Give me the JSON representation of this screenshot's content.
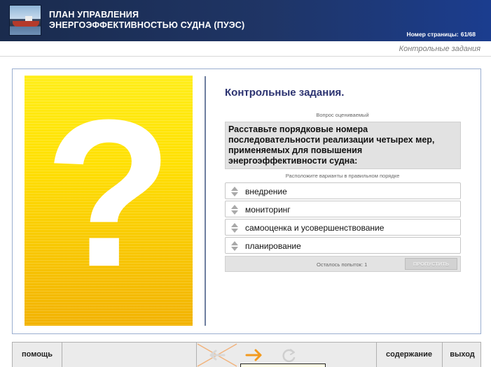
{
  "header": {
    "title_line1": "ПЛАН УПРАВЛЕНИЯ",
    "title_line2": "ЭНЕРГОЭФФЕКТИВНОСТЬЮ СУДНА (ПУЭС)",
    "page_label": "Номер страницы:",
    "page_value": "61/68",
    "thumbnail_icon": "ship-photo"
  },
  "breadcrumb": "Контрольные задания",
  "main": {
    "illustration_glyph": "?",
    "section_title": "Контрольные задания.",
    "question_caption": "Вопрос оцениваемый",
    "question_text": "Расставьте  порядковые номера последовательности реализации четырех мер, применяемых для повышения энергоэффективности судна:",
    "instruction": "Расположите варианты в правильном порядке",
    "options": [
      {
        "label": "внедрение",
        "icon": "sort-arrows-icon"
      },
      {
        "label": "мониторинг",
        "icon": "sort-arrows-icon"
      },
      {
        "label": "самооценка и усовершенствование",
        "icon": "sort-arrows-icon"
      },
      {
        "label": "планирование",
        "icon": "sort-arrows-icon"
      }
    ],
    "attempts_text": "Осталось попыток: 1",
    "skip_label": "ПРОПУСТИТЬ"
  },
  "toolbar": {
    "help_label": "помощь",
    "contents_label": "содержание",
    "exit_label": "выход",
    "back_icon": "back-arrow-disabled-icon",
    "forward_icon": "forward-arrow-icon",
    "reload_icon": "reload-icon"
  },
  "colors": {
    "header_bg": "#1f3566",
    "title_blue": "#2b3270",
    "art_yellow": "#ffe000",
    "forward_orange": "#f29a1f",
    "disabled_cross": "#f2b27a"
  }
}
